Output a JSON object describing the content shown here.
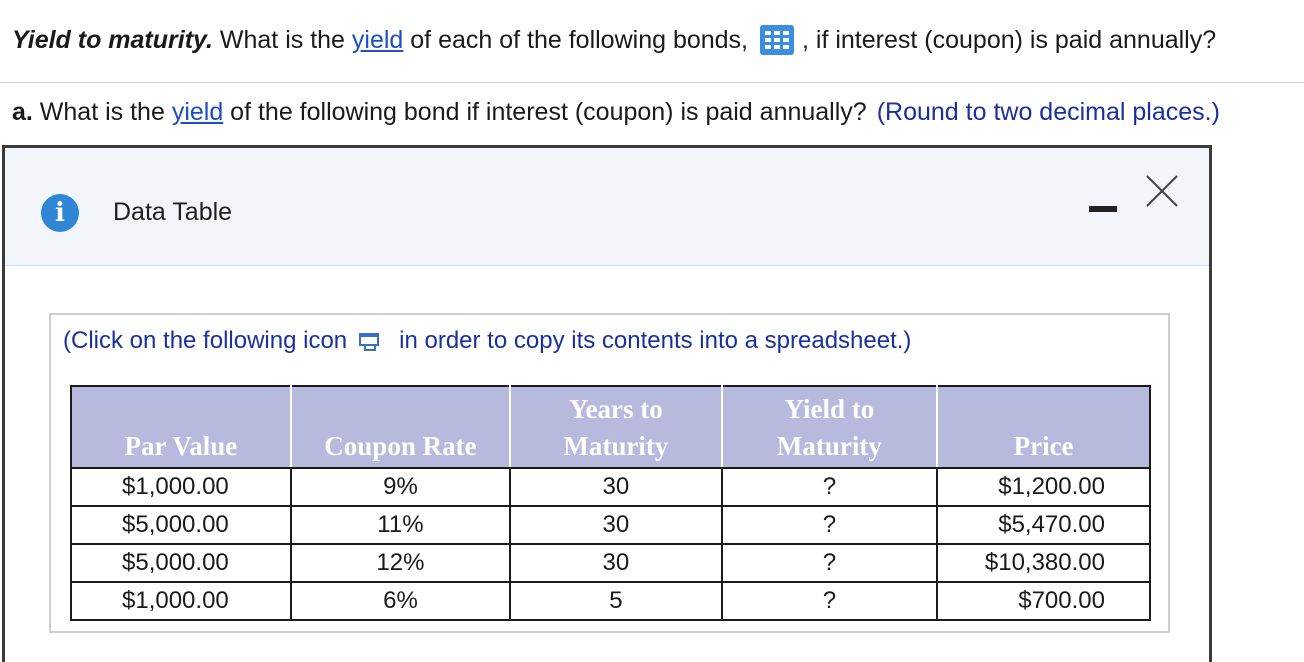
{
  "question": {
    "lead_bold": "Yield to maturity.",
    "text_before_link": " What is the ",
    "link": "yield",
    "text_after_link": " of each of the following bonds,",
    "text_after_icon": ", if interest (coupon) is paid annually?"
  },
  "part_a": {
    "label": "a.",
    "text_before_link": " What is the ",
    "link": "yield",
    "text_after_link": " of the following bond if interest (coupon) is paid annually?",
    "hint": "(Round to two decimal places.)"
  },
  "dialog": {
    "title": "Data Table",
    "icons": {
      "info": "info-icon",
      "minimize": "minimize-icon",
      "close": "close-icon"
    },
    "info_glyph": "i",
    "copy_hint_before": "(Click on the following icon",
    "copy_hint_after": "in order to copy its contents into a spreadsheet.)"
  },
  "table": {
    "headers": {
      "par": "Par Value",
      "coupon": "Coupon Rate",
      "years_line1": "Years to",
      "years_line2": "Maturity",
      "ytm_line1": "Yield to",
      "ytm_line2": "Maturity",
      "price": "Price"
    },
    "rows": [
      {
        "par": "$1,000.00",
        "coupon": "9%",
        "years": "30",
        "ytm": "?",
        "price": "$1,200.00"
      },
      {
        "par": "$5,000.00",
        "coupon": "11%",
        "years": "30",
        "ytm": "?",
        "price": "$5,470.00"
      },
      {
        "par": "$5,000.00",
        "coupon": "12%",
        "years": "30",
        "ytm": "?",
        "price": "$10,380.00"
      },
      {
        "par": "$1,000.00",
        "coupon": "6%",
        "years": "5",
        "ytm": "?",
        "price": "$700.00"
      }
    ]
  },
  "colors": {
    "link": "#1a4fc9",
    "hint": "#1a2fa0",
    "header_bg": "#b7b9dd",
    "info_bg": "#2f86d4"
  }
}
